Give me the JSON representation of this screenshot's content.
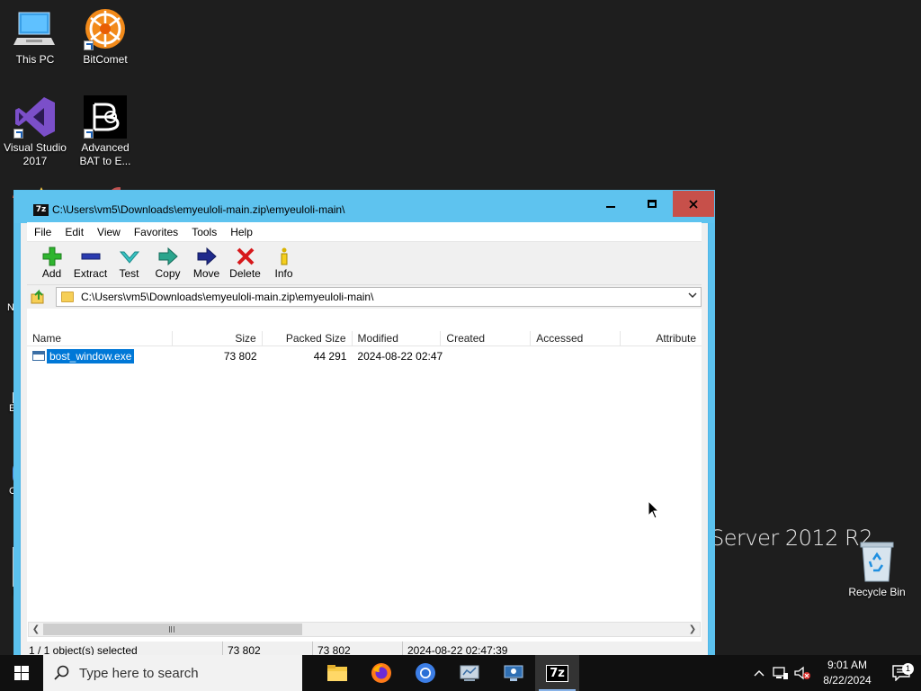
{
  "desktop": {
    "icons": [
      {
        "label": "This PC"
      },
      {
        "label": "BitComet"
      },
      {
        "label": "Visual Studio 2017",
        "line1": "Visual Studio",
        "line2": "2017"
      },
      {
        "label": "Advanced BAT to E...",
        "line1": "Advanced",
        "line2": "BAT to E..."
      },
      {
        "label": "Recycle Bin"
      }
    ],
    "clipped_labels": [
      "No",
      "Ev",
      "Ch",
      "In"
    ],
    "server_brand": "Server 2012 R2"
  },
  "window": {
    "app_badge": "7z",
    "title": "C:\\Users\\vm5\\Downloads\\emyeuloli-main.zip\\emyeuloli-main\\",
    "menu": [
      "File",
      "Edit",
      "View",
      "Favorites",
      "Tools",
      "Help"
    ],
    "toolbar": [
      {
        "label": "Add",
        "icon": "add-icon"
      },
      {
        "label": "Extract",
        "icon": "extract-icon"
      },
      {
        "label": "Test",
        "icon": "test-icon"
      },
      {
        "label": "Copy",
        "icon": "copy-icon"
      },
      {
        "label": "Move",
        "icon": "move-icon"
      },
      {
        "label": "Delete",
        "icon": "delete-icon"
      },
      {
        "label": "Info",
        "icon": "info-icon"
      }
    ],
    "address": "C:\\Users\\vm5\\Downloads\\emyeuloli-main.zip\\emyeuloli-main\\",
    "columns": [
      "Name",
      "Size",
      "Packed Size",
      "Modified",
      "Created",
      "Accessed",
      "Attribute"
    ],
    "rows": [
      {
        "name": "bost_window.exe",
        "size": "73 802",
        "packed": "44 291",
        "modified": "2024-08-22 02:47",
        "created": "",
        "accessed": "",
        "attributes": ""
      }
    ],
    "status": {
      "selection": "1 / 1 object(s) selected",
      "size": "73 802",
      "packed": "73 802",
      "modified": "2024-08-22 02:47:39"
    }
  },
  "taskbar": {
    "search_placeholder": "Type here to search",
    "apps": [
      {
        "name": "File Explorer",
        "icon": "folder-icon"
      },
      {
        "name": "Firefox",
        "icon": "firefox-icon"
      },
      {
        "name": "Chrome",
        "icon": "chrome-icon"
      },
      {
        "name": "Server Manager",
        "icon": "server-manager-icon"
      },
      {
        "name": "Remote Desktop",
        "icon": "remote-desktop-icon"
      },
      {
        "name": "7-Zip",
        "icon": "7zip-icon",
        "badge": "7z"
      }
    ],
    "time": "9:01 AM",
    "date": "8/22/2024",
    "notification_count": "1"
  },
  "colors": {
    "window_frame": "#5ec3ef",
    "close_button": "#c7504a",
    "selection": "#0078d7",
    "taskbar": "#101010"
  }
}
